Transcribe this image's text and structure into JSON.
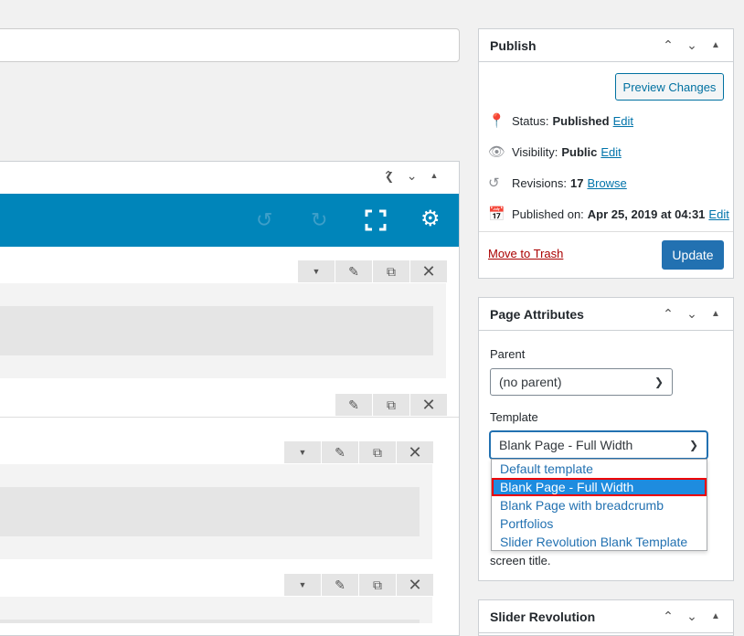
{
  "editor": {
    "toolbar_icons": [
      "undo-icon",
      "redo-icon",
      "fullscreen-icon",
      "gear-icon"
    ],
    "row_controls": [
      "chevron-down-icon",
      "pencil-icon",
      "duplicate-icon",
      "close-icon"
    ],
    "colors": {
      "toolbar": "#0085ba",
      "row_bg": "#f3f3f3",
      "inner_bg": "#e5e5e5"
    }
  },
  "publish": {
    "title": "Publish",
    "preview_label": "Preview Changes",
    "status_label": "Status:",
    "status_value": "Published",
    "visibility_label": "Visibility:",
    "visibility_value": "Public",
    "revisions_label": "Revisions:",
    "revisions_value": "17",
    "browse_label": "Browse",
    "published_label": "Published on:",
    "published_value": "Apr 25, 2019 at 04:31",
    "edit_label": "Edit",
    "trash_label": "Move to Trash",
    "update_label": "Update"
  },
  "page_attributes": {
    "title": "Page Attributes",
    "parent_label": "Parent",
    "parent_value": "(no parent)",
    "template_label": "Template",
    "template_value": "Blank Page - Full Width",
    "template_options": [
      "Default template",
      "Blank Page - Full Width",
      "Blank Page with breadcrumb",
      "Portfolios",
      "Slider Revolution Blank Template"
    ],
    "selected_index": 1,
    "help_tail": "screen title."
  },
  "slider_revolution": {
    "title": "Slider Revolution"
  },
  "postbox_controls": [
    "chevron-up-icon",
    "chevron-down-icon",
    "triangle-up-icon"
  ]
}
